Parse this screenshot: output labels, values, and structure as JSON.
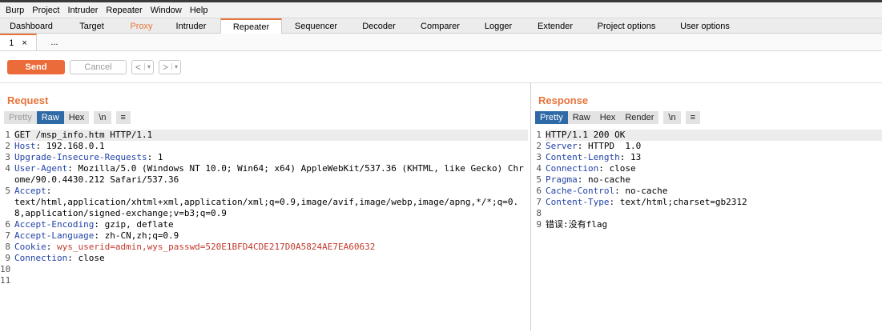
{
  "menu": [
    "Burp",
    "Project",
    "Intruder",
    "Repeater",
    "Window",
    "Help"
  ],
  "tabs": [
    {
      "label": "Dashboard"
    },
    {
      "label": "Target"
    },
    {
      "label": "Proxy"
    },
    {
      "label": "Intruder"
    },
    {
      "label": "Repeater"
    },
    {
      "label": "Sequencer"
    },
    {
      "label": "Decoder"
    },
    {
      "label": "Comparer"
    },
    {
      "label": "Logger"
    },
    {
      "label": "Extender"
    },
    {
      "label": "Project options"
    },
    {
      "label": "User options"
    }
  ],
  "subtabs": {
    "active": "1",
    "close": "×",
    "more": "..."
  },
  "toolbar": {
    "send": "Send",
    "cancel": "Cancel",
    "back": "<",
    "forward": ">",
    "dropdown": "▾"
  },
  "request": {
    "title": "Request",
    "view_tabs": [
      "Pretty",
      "Raw",
      "Hex",
      "\\n",
      "≡"
    ],
    "lines": [
      {
        "n": "1",
        "name": "",
        "value": "GET /msp_info.htm HTTP/1.1"
      },
      {
        "n": "2",
        "name": "Host",
        "value": ": 192.168.0.1"
      },
      {
        "n": "3",
        "name": "Upgrade-Insecure-Requests",
        "value": ": 1"
      },
      {
        "n": "4",
        "name": "User-Agent",
        "value": ": Mozilla/5.0 (Windows NT 10.0; Win64; x64) AppleWebKit/537.36 (KHTML, like Gecko) Chrome/90.0.4430.212 Safari/537.36"
      },
      {
        "n": "5",
        "name": "Accept",
        "value": ":\ntext/html,application/xhtml+xml,application/xml;q=0.9,image/avif,image/webp,image/apng,*/*;q=0.8,application/signed-exchange;v=b3;q=0.9"
      },
      {
        "n": "6",
        "name": "Accept-Encoding",
        "value": ": gzip, deflate"
      },
      {
        "n": "7",
        "name": "Accept-Language",
        "value": ": zh-CN,zh;q=0.9"
      },
      {
        "n": "8",
        "name": "Cookie",
        "value": ": ",
        "cookie": "wys_userid=admin,wys_passwd=520E1BFD4CDE217D0A5824AE7EA60632"
      },
      {
        "n": "9",
        "name": "Connection",
        "value": ": close"
      },
      {
        "n": "10",
        "name": "",
        "value": ""
      },
      {
        "n": "11",
        "name": "",
        "value": ""
      }
    ]
  },
  "response": {
    "title": "Response",
    "view_tabs": [
      "Pretty",
      "Raw",
      "Hex",
      "Render",
      "\\n",
      "≡"
    ],
    "lines": [
      {
        "n": "1",
        "name": "",
        "value": "HTTP/1.1 200 OK"
      },
      {
        "n": "2",
        "name": "Server",
        "value": ": HTTPD  1.0"
      },
      {
        "n": "3",
        "name": "Content-Length",
        "value": ": 13"
      },
      {
        "n": "4",
        "name": "Connection",
        "value": ": close"
      },
      {
        "n": "5",
        "name": "Pragma",
        "value": ": no-cache"
      },
      {
        "n": "6",
        "name": "Cache-Control",
        "value": ": no-cache"
      },
      {
        "n": "7",
        "name": "Content-Type",
        "value": ": text/html;charset=gb2312"
      },
      {
        "n": "8",
        "name": "",
        "value": ""
      },
      {
        "n": "9",
        "name": "",
        "value": "错误:没有flag"
      }
    ]
  },
  "colors": {
    "accent": "#e8743b",
    "send": "#ec6b3a",
    "selected_tab": "#2e6aa5",
    "header_name": "#2343a7",
    "cookie": "#c0392b"
  }
}
